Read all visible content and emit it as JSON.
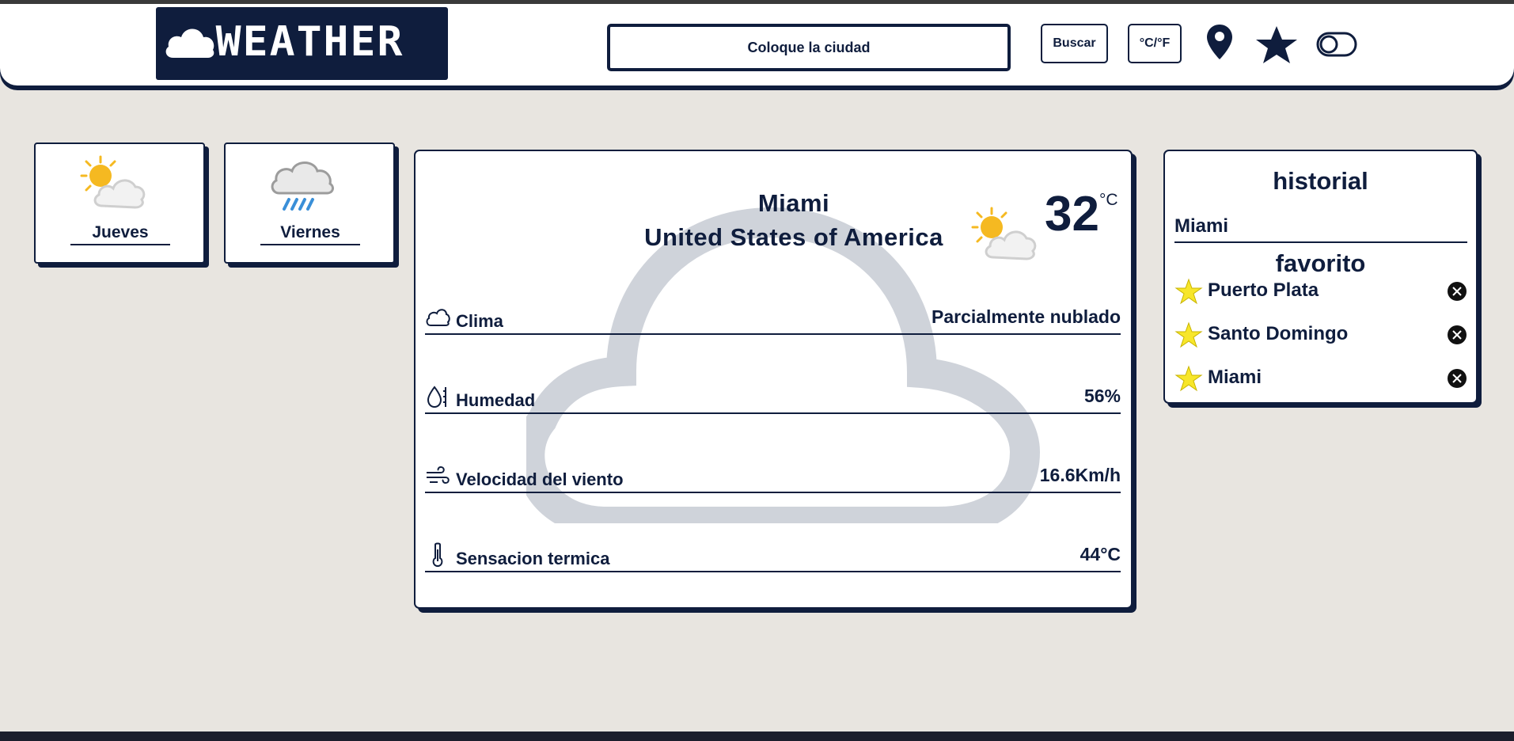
{
  "header": {
    "logo_text": "WEATHER",
    "search_placeholder": "Coloque la ciudad",
    "search_button": "Buscar",
    "unit_toggle": "°C/°F",
    "icons": [
      "location-pin-icon",
      "star-icon",
      "toggle-switch-icon"
    ]
  },
  "forecast": [
    {
      "day": "Jueves",
      "icon": "partly-cloudy-icon"
    },
    {
      "day": "Viernes",
      "icon": "rain-cloud-icon"
    }
  ],
  "current": {
    "city": "Miami",
    "country": "United States of America",
    "temperature": "32",
    "temperature_unit": "°C",
    "icon": "partly-cloudy-icon",
    "details": [
      {
        "label": "Clima",
        "value": "Parcialmente nublado",
        "icon": "cloud-outline-icon"
      },
      {
        "label": "Humedad",
        "value": "56%",
        "icon": "humidity-icon"
      },
      {
        "label": "Velocidad del viento",
        "value": "16.6Km/h",
        "icon": "wind-icon"
      },
      {
        "label": "Sensacion termica",
        "value": "44°C",
        "icon": "thermometer-icon"
      }
    ]
  },
  "sidebar": {
    "history_title": "historial",
    "history": [
      "Miami"
    ],
    "favorites_title": "favorito",
    "favorites": [
      "Puerto Plata",
      "Santo Domingo",
      "Miami"
    ]
  },
  "colors": {
    "navy": "#0f1d3d",
    "background": "#e8e5e0",
    "star_yellow": "#f7e62a",
    "sun": "#f5b921",
    "rain": "#3a8fd8"
  }
}
